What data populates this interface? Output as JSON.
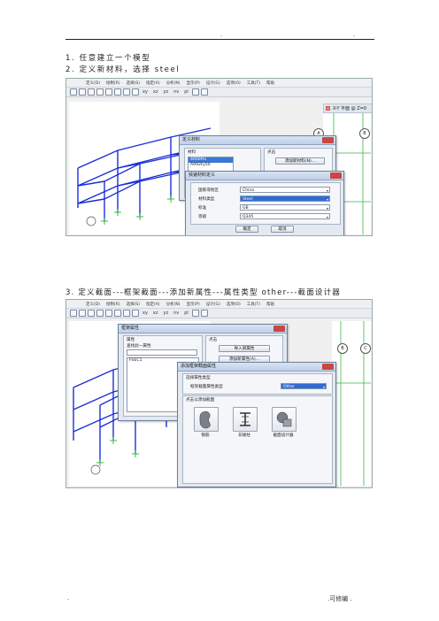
{
  "header": {
    "left_mark": ".",
    "right_mark": "."
  },
  "steps": [
    {
      "text": "1. 任意建立一个模型"
    },
    {
      "text": "2. 定义新材料，选择 steel"
    },
    {
      "text": "3. 定义截面---框架截面---添加新属性---属性类型 other---截面设计器"
    }
  ],
  "shot1": {
    "menu": [
      "定义(D)",
      "绘制(R)",
      "选择(S)",
      "指定(A)",
      "分析(N)",
      "显示(P)",
      "设计(G)",
      "选项(O)",
      "工具(T)",
      "帮助"
    ],
    "toolbar_texts": [
      "xy",
      "xz",
      "yz",
      "nv",
      "pl"
    ],
    "view_tab": "X-Y 平面 @ Z=0",
    "axis_labels": [
      "A",
      "B"
    ],
    "define_materials": {
      "title": "定义材料",
      "materials_label": "材料",
      "material_items": [
        "4000Psi",
        "A992Fy50"
      ],
      "click_to_label": "点击",
      "add_button": "添加新材料(N)..."
    },
    "quick_define": {
      "title": "快速材料定义",
      "fields": [
        {
          "label": "国家或地区",
          "value": "China"
        },
        {
          "label": "材料类型",
          "value": "Steel"
        },
        {
          "label": "标准",
          "value": "GB"
        },
        {
          "label": "等级",
          "value": "Q345"
        }
      ],
      "ok": "确定",
      "cancel": "取消"
    }
  },
  "shot2": {
    "menu": [
      "定义(D)",
      "绘制(R)",
      "选择(S)",
      "指定(A)",
      "分析(N)",
      "显示(P)",
      "设计(G)",
      "选项(O)",
      "工具(T)",
      "帮助"
    ],
    "toolbar_texts": [
      "xy",
      "xz",
      "yz",
      "nv",
      "pl"
    ],
    "axis_labels": [
      "B",
      "C"
    ],
    "frame_props": {
      "title": "框架属性",
      "props_label": "属性",
      "find_label": "查找此一属性",
      "items": [
        "FSEC1"
      ],
      "click_to_label": "点击",
      "import_button": "导入新属性",
      "add_button": "添加新属性(A)..."
    },
    "add_frame": {
      "title": "添加框架截面属性",
      "type_group": "选择属性类型",
      "type_label": "框架截面属性类型",
      "type_value": "Other",
      "click_group": "点击以添加截面",
      "options": [
        {
          "label": "钢筋",
          "icon": "bean-shape-icon"
        },
        {
          "label": "非棱柱",
          "icon": "i-beam-icon"
        },
        {
          "label": "截面设计器",
          "icon": "shape-designer-icon"
        }
      ]
    }
  },
  "footer": {
    "left_mark": ".",
    "right_text": ".可修编 ."
  }
}
